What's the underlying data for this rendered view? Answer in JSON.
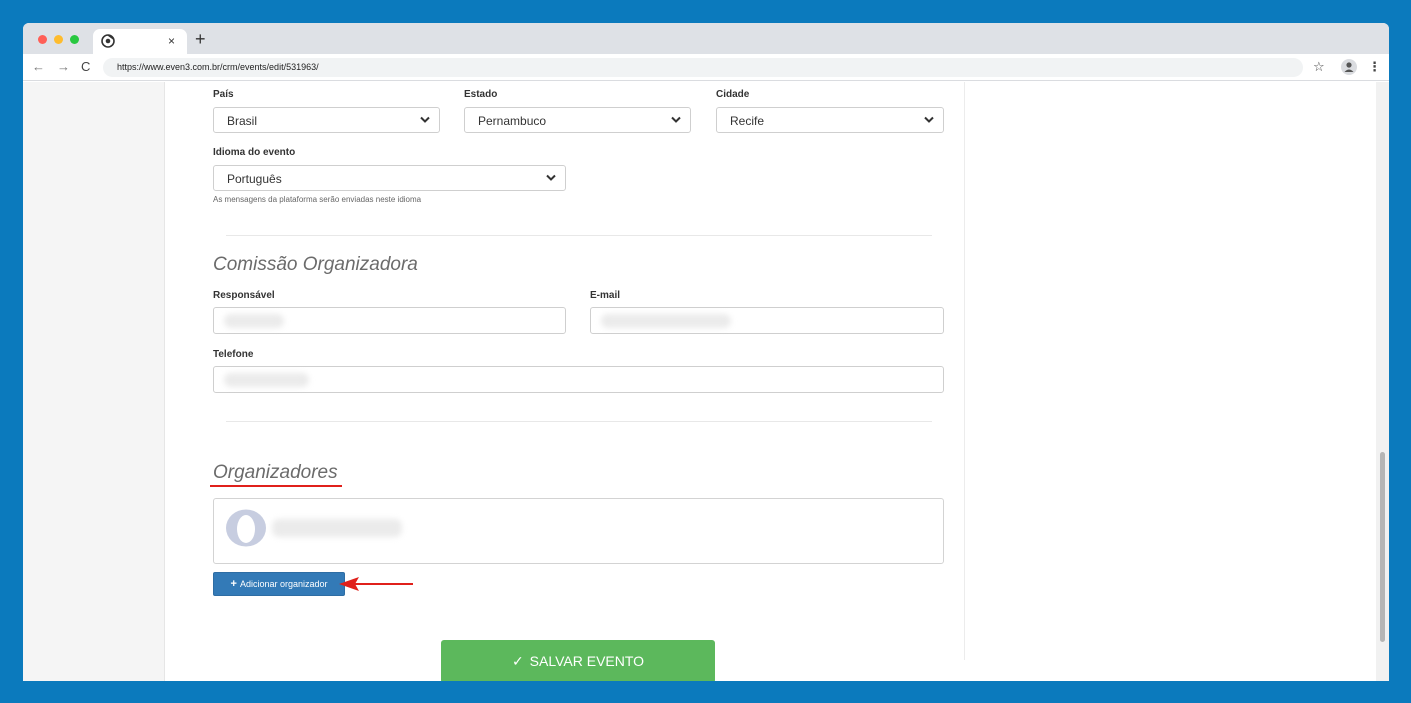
{
  "browser": {
    "url": "https://www.even3.com.br/crm/events/edit/531963/",
    "new_tab": "+",
    "close_tab": "×"
  },
  "form": {
    "pais_label": "País",
    "pais_value": "Brasil",
    "estado_label": "Estado",
    "estado_value": "Pernambuco",
    "cidade_label": "Cidade",
    "cidade_value": "Recife",
    "idioma_label": "Idioma do evento",
    "idioma_value": "Português",
    "idioma_hint": "As mensagens da plataforma serão enviadas neste idioma"
  },
  "comissao": {
    "title": "Comissão Organizadora",
    "responsavel_label": "Responsável",
    "email_label": "E-mail",
    "telefone_label": "Telefone"
  },
  "organizadores": {
    "title": "Organizadores",
    "add_button_label": "Adicionar organizador"
  },
  "save_button_label": "SALVAR EVENTO",
  "colors": {
    "accent_blue": "#337ab7",
    "save_green": "#5cb85c",
    "annotation_red": "#e0201b",
    "background_blue": "#0b7abd"
  }
}
